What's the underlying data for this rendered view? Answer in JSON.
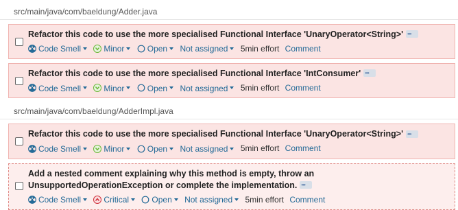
{
  "files": [
    {
      "path": "src/main/java/com/baeldung/Adder.java",
      "issues": [
        {
          "message": "Refactor this code to use the more specialised Functional Interface 'UnaryOperator<String>'",
          "type": "Code Smell",
          "severity": "Minor",
          "status": "Open",
          "assignee": "Not assigned",
          "effort": "5min effort",
          "comment": "Comment"
        },
        {
          "message": "Refactor this code to use the more specialised Functional Interface 'IntConsumer'",
          "type": "Code Smell",
          "severity": "Minor",
          "status": "Open",
          "assignee": "Not assigned",
          "effort": "5min effort",
          "comment": "Comment"
        }
      ]
    },
    {
      "path": "src/main/java/com/baeldung/AdderImpl.java",
      "issues": [
        {
          "message": "Refactor this code to use the more specialised Functional Interface 'UnaryOperator<String>'",
          "type": "Code Smell",
          "severity": "Minor",
          "status": "Open",
          "assignee": "Not assigned",
          "effort": "5min effort",
          "comment": "Comment"
        },
        {
          "message": "Add a nested comment explaining why this method is empty, throw an UnsupportedOperationException or complete the implementation.",
          "type": "Code Smell",
          "severity": "Critical",
          "status": "Open",
          "assignee": "Not assigned",
          "effort": "5min effort",
          "comment": "Comment"
        }
      ]
    }
  ],
  "icons": {
    "type": "code-smell-icon",
    "minor": "minor-severity-icon",
    "critical": "critical-severity-icon",
    "status": "open-status-icon"
  },
  "colors": {
    "link": "#236a97",
    "issue_bg": "#fbe4e3",
    "minor": "#6cb83a",
    "critical": "#d02f3a"
  }
}
